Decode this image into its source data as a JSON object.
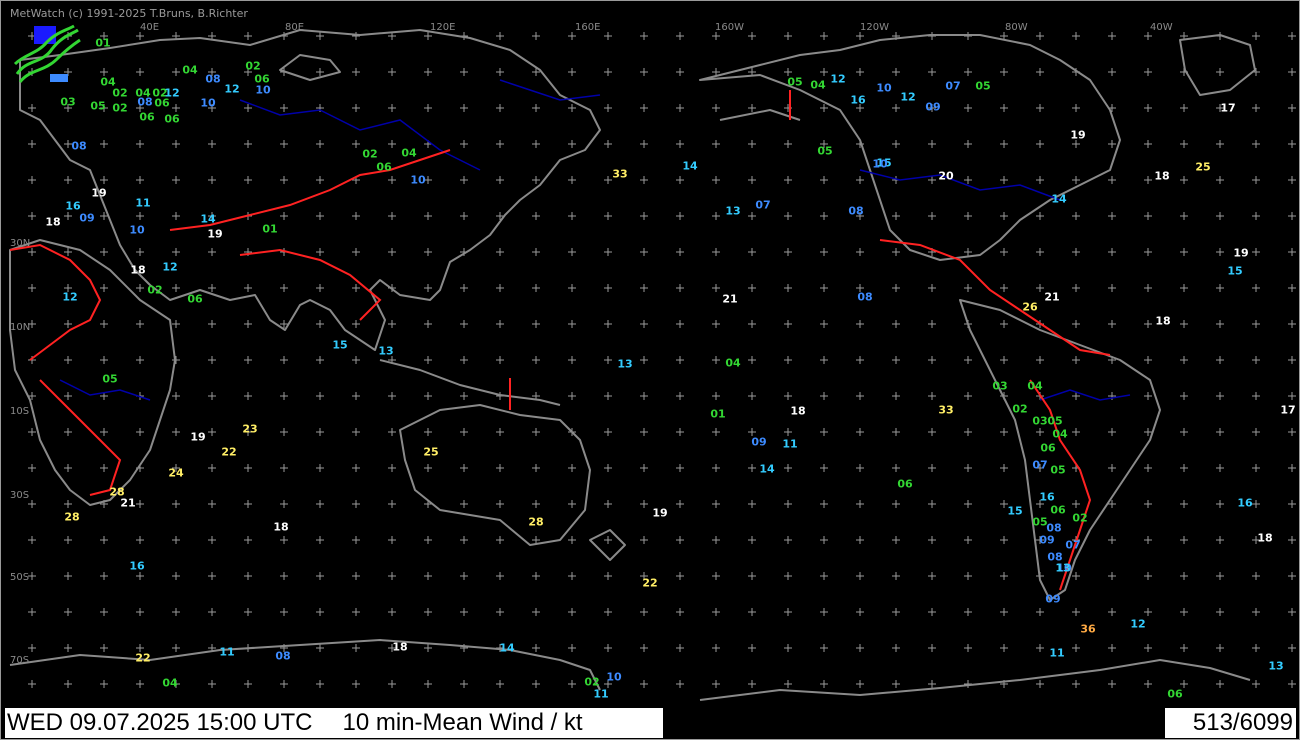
{
  "app": {
    "credit": "MetWatch  (c) 1991-2025 T.Bruns, B.Richter"
  },
  "footer": {
    "timestamp": "WED 09.07.2025 15:00 UTC",
    "title": "10 min-Mean Wind / kt",
    "count": "513/6099"
  },
  "map": {
    "lon_labels": [
      "40E",
      "80E",
      "120E",
      "160E",
      "160W",
      "120W",
      "80W",
      "40W"
    ],
    "lat_labels": [
      "30N",
      "10N",
      "10S",
      "30S",
      "50S",
      "70S"
    ]
  },
  "colors": {
    "green": "#33d633",
    "blue": "#3d8bff",
    "cyan": "#33ccff",
    "white": "#ffffff",
    "yellow": "#ffee66",
    "orange": "#ffaa44",
    "coast": "#8a8a8a",
    "border": "#ff2222",
    "river": "#0000aa"
  },
  "observations": [
    {
      "v": "01",
      "c": "green"
    },
    {
      "v": "04",
      "c": "green"
    },
    {
      "v": "02",
      "c": "green"
    },
    {
      "v": "06",
      "c": "green"
    },
    {
      "v": "08",
      "c": "blue"
    },
    {
      "v": "12",
      "c": "cyan"
    },
    {
      "v": "10",
      "c": "blue"
    },
    {
      "v": "04",
      "c": "green"
    },
    {
      "v": "02",
      "c": "green"
    },
    {
      "v": "04",
      "c": "green"
    },
    {
      "v": "02",
      "c": "green"
    },
    {
      "v": "08",
      "c": "blue"
    },
    {
      "v": "12",
      "c": "cyan"
    },
    {
      "v": "10",
      "c": "blue"
    },
    {
      "v": "03",
      "c": "green"
    },
    {
      "v": "05",
      "c": "green"
    },
    {
      "v": "02",
      "c": "green"
    },
    {
      "v": "06",
      "c": "green"
    },
    {
      "v": "08",
      "c": "blue"
    },
    {
      "v": "06",
      "c": "green"
    },
    {
      "v": "06",
      "c": "green"
    },
    {
      "v": "19",
      "c": "white"
    },
    {
      "v": "18",
      "c": "white"
    },
    {
      "v": "16",
      "c": "cyan"
    },
    {
      "v": "09",
      "c": "blue"
    },
    {
      "v": "11",
      "c": "cyan"
    },
    {
      "v": "14",
      "c": "cyan"
    },
    {
      "v": "10",
      "c": "blue"
    },
    {
      "v": "12",
      "c": "cyan"
    },
    {
      "v": "19",
      "c": "white"
    },
    {
      "v": "18",
      "c": "white"
    },
    {
      "v": "12",
      "c": "cyan"
    },
    {
      "v": "06",
      "c": "green"
    },
    {
      "v": "05",
      "c": "green"
    },
    {
      "v": "02",
      "c": "green"
    },
    {
      "v": "23",
      "c": "yellow"
    },
    {
      "v": "22",
      "c": "yellow"
    },
    {
      "v": "24",
      "c": "yellow"
    },
    {
      "v": "28",
      "c": "yellow"
    },
    {
      "v": "21",
      "c": "white"
    },
    {
      "v": "28",
      "c": "yellow"
    },
    {
      "v": "19",
      "c": "white"
    },
    {
      "v": "02",
      "c": "green"
    },
    {
      "v": "06",
      "c": "green"
    },
    {
      "v": "04",
      "c": "green"
    },
    {
      "v": "10",
      "c": "blue"
    },
    {
      "v": "01",
      "c": "green"
    },
    {
      "v": "15",
      "c": "cyan"
    },
    {
      "v": "13",
      "c": "cyan"
    },
    {
      "v": "33",
      "c": "yellow"
    },
    {
      "v": "14",
      "c": "cyan"
    },
    {
      "v": "21",
      "c": "white"
    },
    {
      "v": "08",
      "c": "blue"
    },
    {
      "v": "13",
      "c": "cyan"
    },
    {
      "v": "07",
      "c": "blue"
    },
    {
      "v": "04",
      "c": "green"
    },
    {
      "v": "01",
      "c": "green"
    },
    {
      "v": "18",
      "c": "white"
    },
    {
      "v": "33",
      "c": "yellow"
    },
    {
      "v": "09",
      "c": "blue"
    },
    {
      "v": "11",
      "c": "cyan"
    },
    {
      "v": "14",
      "c": "cyan"
    },
    {
      "v": "06",
      "c": "green"
    },
    {
      "v": "25",
      "c": "yellow"
    },
    {
      "v": "28",
      "c": "yellow"
    },
    {
      "v": "13",
      "c": "cyan"
    },
    {
      "v": "19",
      "c": "white"
    },
    {
      "v": "22",
      "c": "yellow"
    },
    {
      "v": "18",
      "c": "white"
    },
    {
      "v": "16",
      "c": "cyan"
    },
    {
      "v": "20",
      "c": "white"
    },
    {
      "v": "19",
      "c": "white"
    },
    {
      "v": "21",
      "c": "white"
    },
    {
      "v": "26",
      "c": "yellow"
    },
    {
      "v": "18",
      "c": "white"
    },
    {
      "v": "25",
      "c": "yellow"
    },
    {
      "v": "17",
      "c": "white"
    },
    {
      "v": "19",
      "c": "white"
    },
    {
      "v": "15",
      "c": "cyan"
    },
    {
      "v": "18",
      "c": "white"
    },
    {
      "v": "17",
      "c": "white"
    },
    {
      "v": "16",
      "c": "cyan"
    },
    {
      "v": "18",
      "c": "white"
    },
    {
      "v": "13",
      "c": "cyan"
    },
    {
      "v": "36",
      "c": "orange"
    },
    {
      "v": "12",
      "c": "cyan"
    },
    {
      "v": "11",
      "c": "cyan"
    },
    {
      "v": "06",
      "c": "green"
    },
    {
      "v": "22",
      "c": "yellow"
    },
    {
      "v": "04",
      "c": "green"
    },
    {
      "v": "11",
      "c": "cyan"
    },
    {
      "v": "08",
      "c": "blue"
    },
    {
      "v": "18",
      "c": "white"
    },
    {
      "v": "14",
      "c": "cyan"
    },
    {
      "v": "02",
      "c": "green"
    },
    {
      "v": "10",
      "c": "blue"
    },
    {
      "v": "11",
      "c": "cyan"
    },
    {
      "v": "05",
      "c": "green"
    },
    {
      "v": "04",
      "c": "green"
    },
    {
      "v": "12",
      "c": "cyan"
    },
    {
      "v": "10",
      "c": "blue"
    },
    {
      "v": "16",
      "c": "cyan"
    },
    {
      "v": "15",
      "c": "cyan"
    },
    {
      "v": "14",
      "c": "cyan"
    },
    {
      "v": "05",
      "c": "green"
    },
    {
      "v": "08",
      "c": "blue"
    },
    {
      "v": "10",
      "c": "blue"
    },
    {
      "v": "12",
      "c": "cyan"
    },
    {
      "v": "09",
      "c": "blue"
    },
    {
      "v": "07",
      "c": "blue"
    },
    {
      "v": "05",
      "c": "green"
    },
    {
      "v": "03",
      "c": "green"
    },
    {
      "v": "04",
      "c": "green"
    },
    {
      "v": "05",
      "c": "green"
    },
    {
      "v": "06",
      "c": "green"
    },
    {
      "v": "07",
      "c": "blue"
    },
    {
      "v": "08",
      "c": "blue"
    },
    {
      "v": "09",
      "c": "blue"
    },
    {
      "v": "02",
      "c": "green"
    },
    {
      "v": "03",
      "c": "green"
    },
    {
      "v": "04",
      "c": "green"
    },
    {
      "v": "05",
      "c": "green"
    },
    {
      "v": "06",
      "c": "green"
    },
    {
      "v": "08",
      "c": "blue"
    },
    {
      "v": "10",
      "c": "blue"
    },
    {
      "v": "13",
      "c": "cyan"
    },
    {
      "v": "15",
      "c": "cyan"
    },
    {
      "v": "16",
      "c": "cyan"
    },
    {
      "v": "05",
      "c": "green"
    },
    {
      "v": "07",
      "c": "blue"
    },
    {
      "v": "02",
      "c": "green"
    },
    {
      "v": "09",
      "c": "blue"
    }
  ]
}
